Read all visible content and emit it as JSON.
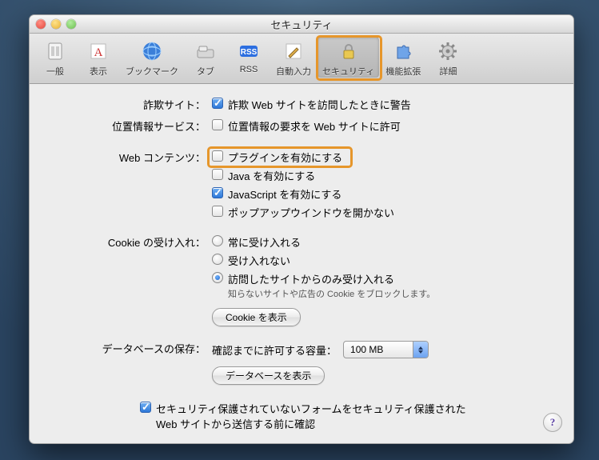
{
  "window": {
    "title": "セキュリティ"
  },
  "toolbar": [
    {
      "id": "general",
      "label": "一般",
      "icon": "switch-icon"
    },
    {
      "id": "appearance",
      "label": "表示",
      "icon": "font-icon"
    },
    {
      "id": "bookmarks",
      "label": "ブックマーク",
      "icon": "globe-icon"
    },
    {
      "id": "tabs",
      "label": "タブ",
      "icon": "tab-icon"
    },
    {
      "id": "rss",
      "label": "RSS",
      "icon": "rss-icon"
    },
    {
      "id": "autofill",
      "label": "自動入力",
      "icon": "pen-icon"
    },
    {
      "id": "security",
      "label": "セキュリティ",
      "icon": "lock-icon",
      "selected": true
    },
    {
      "id": "extensions",
      "label": "機能拡張",
      "icon": "puzzle-icon"
    },
    {
      "id": "advanced",
      "label": "詳細",
      "icon": "gear-icon"
    }
  ],
  "sections": {
    "fraud": {
      "label": "詐欺サイト：",
      "warn": "詐欺 Web サイトを訪問したときに警告",
      "warn_checked": true
    },
    "location": {
      "label": "位置情報サービス：",
      "allow": "位置情報の要求を Web サイトに許可",
      "allow_checked": false
    },
    "webcontent": {
      "label": "Web コンテンツ：",
      "plugins": {
        "label": "プラグインを有効にする",
        "checked": false
      },
      "java": {
        "label": "Java を有効にする",
        "checked": false
      },
      "javascript": {
        "label": "JavaScript を有効にする",
        "checked": true
      },
      "popup": {
        "label": "ポップアップウインドウを開かない",
        "checked": false
      }
    },
    "cookies": {
      "label": "Cookie の受け入れ：",
      "options": {
        "always": "常に受け入れる",
        "never": "受け入れない",
        "visited": "訪問したサイトからのみ受け入れる"
      },
      "selected": "visited",
      "note": "知らないサイトや広告の Cookie をブロックします。",
      "show_btn": "Cookie を表示"
    },
    "database": {
      "label": "データベースの保存：",
      "quota_label": "確認までに許可する容量：",
      "quota_value": "100 MB",
      "show_btn": "データベースを表示"
    },
    "insecure": {
      "label": "セキュリティ保護されていないフォームをセキュリティ保護された Web サイトから送信する前に確認",
      "checked": true
    }
  }
}
